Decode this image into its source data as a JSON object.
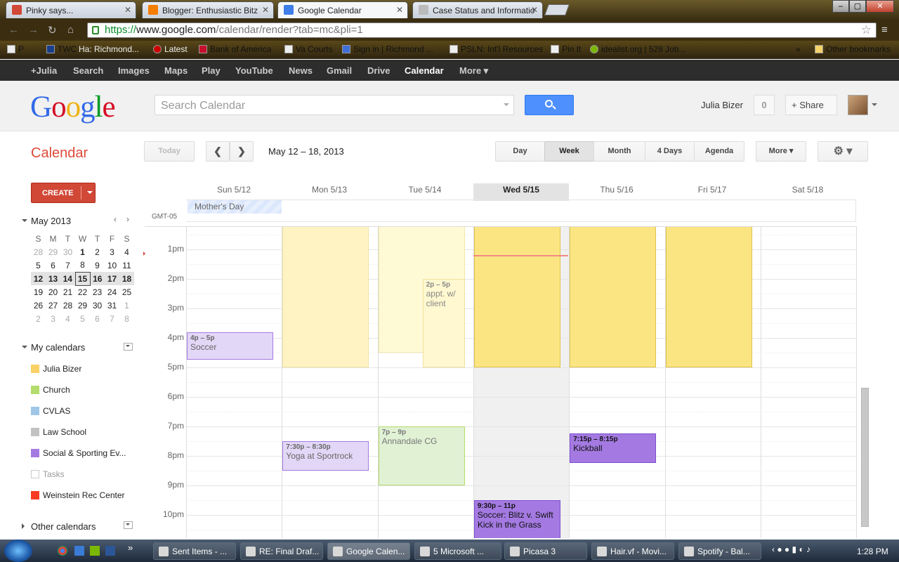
{
  "browser": {
    "tabs": [
      {
        "title": "Pinky says...",
        "color": "#d14836"
      },
      {
        "title": "Blogger: Enthusiastic Bitz",
        "color": "#f57d00"
      },
      {
        "title": "Google Calendar",
        "color": "#3f7ee8"
      },
      {
        "title": "Case Status and Informatio",
        "color": "#bbbbbb"
      }
    ],
    "url_scheme": "https://",
    "url_host": "www.google.com",
    "url_path": "/calendar/render?tab=mc&pli=1",
    "bookmarks": [
      "P",
      "TWC",
      "Ha: Richmond...",
      "Latest",
      "Bank of America",
      "Va Courts",
      "Sign in | Richmond ...",
      "PSLN: Int'l Resources",
      "Pin It",
      "idealist.org | 528 Job..."
    ],
    "other_bookmarks": "Other bookmarks",
    "more_chevron": "»"
  },
  "gbar": [
    "+Julia",
    "Search",
    "Images",
    "Maps",
    "Play",
    "YouTube",
    "News",
    "Gmail",
    "Drive",
    "Calendar",
    "More ▾"
  ],
  "header": {
    "logo": "Google",
    "search_placeholder": "Search Calendar",
    "user_name": "Julia Bizer",
    "notif_count": "0",
    "share_label": "Share"
  },
  "toolbar": {
    "title": "Calendar",
    "today": "Today",
    "prev": "❮",
    "next": "❯",
    "date_range": "May 12 – 18, 2013",
    "views": [
      "Day",
      "Week",
      "Month",
      "4 Days",
      "Agenda"
    ],
    "selected_view": "Week",
    "more": "More ▾",
    "settings": "⚙ ▾"
  },
  "sidebar": {
    "create": "CREATE",
    "mini_month": "May 2013",
    "mini_prev": "‹",
    "mini_next": "›",
    "dow": [
      "S",
      "M",
      "T",
      "W",
      "T",
      "F",
      "S"
    ],
    "weeks": [
      [
        "28",
        "29",
        "30",
        "1",
        "2",
        "3",
        "4"
      ],
      [
        "5",
        "6",
        "7",
        "8",
        "9",
        "10",
        "11"
      ],
      [
        "12",
        "13",
        "14",
        "15",
        "16",
        "17",
        "18"
      ],
      [
        "19",
        "20",
        "21",
        "22",
        "23",
        "24",
        "25"
      ],
      [
        "26",
        "27",
        "28",
        "29",
        "30",
        "31",
        "1"
      ],
      [
        "2",
        "3",
        "4",
        "5",
        "6",
        "7",
        "8"
      ]
    ],
    "my_calendars": "My calendars",
    "calendars": [
      {
        "name": "Julia Bizer",
        "color": "#fad165"
      },
      {
        "name": "Church",
        "color": "#b3dc6c"
      },
      {
        "name": "CVLAS",
        "color": "#9fc6e7"
      },
      {
        "name": "Law School",
        "color": "#c2c2c2"
      },
      {
        "name": "Social & Sporting Ev...",
        "color": "#a47ae2"
      },
      {
        "name": "Tasks",
        "color": "#ffffff"
      },
      {
        "name": "Weinstein Rec Center",
        "color": "#f83a22"
      }
    ],
    "other_calendars": "Other calendars"
  },
  "week": {
    "days": [
      "Sun 5/12",
      "Mon 5/13",
      "Tue 5/14",
      "Wed 5/15",
      "Thu 5/16",
      "Fri 5/17",
      "Sat 5/18"
    ],
    "today_index": 3,
    "timezone": "GMT-05",
    "hours": [
      "1pm",
      "2pm",
      "3pm",
      "4pm",
      "5pm",
      "6pm",
      "7pm",
      "8pm",
      "9pm",
      "10pm"
    ],
    "all_day": [
      {
        "title": "Mother's Day",
        "day": 0
      }
    ]
  },
  "events": [
    {
      "day": 1,
      "start": 12.0,
      "end": 17.0,
      "time": "",
      "title": "",
      "bg": "#fff3c4",
      "border": "#f0e2a0",
      "text": "#777"
    },
    {
      "day": 2,
      "start": 12.0,
      "end": 16.5,
      "time": "",
      "title": "",
      "bg": "#fffad6",
      "border": "#f2e6a8",
      "text": "#777"
    },
    {
      "day": 2,
      "start": 14.0,
      "end": 17.0,
      "time": "2p – 5p",
      "title": "appt. w/ client",
      "bg": "#fff8d0",
      "border": "#f0e2a0",
      "text": "#888",
      "lane": 1
    },
    {
      "day": 3,
      "start": 12.0,
      "end": 17.0,
      "time": "",
      "title": "",
      "bg": "#fbe583",
      "border": "#e0c24a",
      "text": "#333"
    },
    {
      "day": 4,
      "start": 12.0,
      "end": 17.0,
      "time": "",
      "title": "",
      "bg": "#fbe583",
      "border": "#e0c24a",
      "text": "#333"
    },
    {
      "day": 5,
      "start": 12.0,
      "end": 17.0,
      "time": "",
      "title": "",
      "bg": "#fbe583",
      "border": "#e0c24a",
      "text": "#333"
    },
    {
      "day": 0,
      "start": 15.83,
      "end": 16.75,
      "time": "4p – 5p",
      "title": "Soccer",
      "bg": "#e3d7f7",
      "border": "#a47ae2",
      "text": "#666"
    },
    {
      "day": 1,
      "start": 19.5,
      "end": 20.5,
      "time": "7:30p – 8:30p",
      "title": "Yoga at Sportrock",
      "bg": "#e3d7f7",
      "border": "#a47ae2",
      "text": "#666"
    },
    {
      "day": 2,
      "start": 19.0,
      "end": 21.0,
      "time": "7p – 9p",
      "title": "Annandale CG",
      "bg": "#e1f1d4",
      "border": "#b3dc6c",
      "text": "#777"
    },
    {
      "day": 4,
      "start": 19.25,
      "end": 20.25,
      "time": "7:15p – 8:15p",
      "title": "Kickball",
      "bg": "#a47ae2",
      "border": "#7d4fd0",
      "text": "#111"
    },
    {
      "day": 3,
      "start": 21.5,
      "end": 22.9,
      "time": "9:30p – 11p",
      "title": "Soccer: Blitz v. Swift Kick in the Grass",
      "bg": "#a47ae2",
      "border": "#7d4fd0",
      "text": "#111"
    }
  ],
  "taskbar": {
    "items": [
      "Sent Items - ...",
      "RE: Final Draf...",
      "Google Calen...",
      "5 Microsoft ...",
      "Picasa 3",
      "Hair.vf - Movi...",
      "Spotify - Bal..."
    ],
    "clock": "1:28 PM",
    "quick_more": "»",
    "tray_arrow": "‹"
  }
}
